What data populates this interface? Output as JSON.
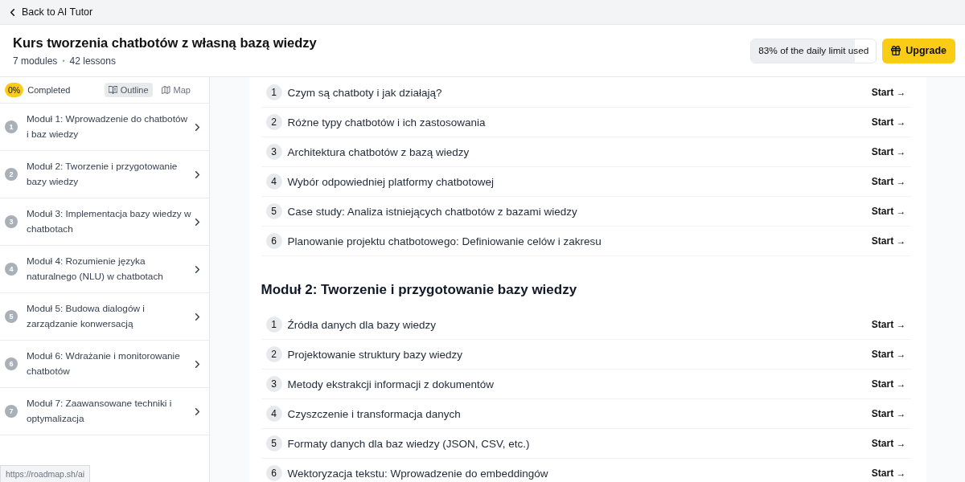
{
  "top_bar": {
    "back_link": "Back to AI Tutor"
  },
  "header": {
    "title": "Kurs tworzenia chatbotów z własną bazą wiedzy",
    "modules_count": "7 modules",
    "separator": "•",
    "lessons_count": "42 lessons",
    "usage": {
      "label": "83% of the daily limit used",
      "level": 0.83
    },
    "upgrade_button": "Upgrade"
  },
  "sidebar": {
    "progress_badge": "0%",
    "progress_label": "Completed",
    "tabs": [
      {
        "label": "Outline",
        "selected": true
      },
      {
        "label": "Map",
        "selected": false
      }
    ],
    "modules": [
      {
        "number": "1",
        "title": "Moduł 1: Wprowadzenie do chatbotów i baz wiedzy"
      },
      {
        "number": "2",
        "title": "Moduł 2: Tworzenie i przygotowanie bazy wiedzy"
      },
      {
        "number": "3",
        "title": "Moduł 3: Implementacja bazy wiedzy w chatbotach"
      },
      {
        "number": "4",
        "title": "Moduł 4: Rozumienie języka naturalnego (NLU) w chatbotach"
      },
      {
        "number": "5",
        "title": "Moduł 5: Budowa dialogów i zarządzanie konwersacją"
      },
      {
        "number": "6",
        "title": "Moduł 6: Wdrażanie i monitorowanie chatbotów"
      },
      {
        "number": "7",
        "title": "Moduł 7: Zaawansowane techniki i optymalizacja"
      }
    ]
  },
  "content": {
    "sections": [
      {
        "lessons": [
          {
            "number": "1",
            "title": "Czym są chatboty i jak działają?",
            "action": "Start →"
          },
          {
            "number": "2",
            "title": "Różne typy chatbotów i ich zastosowania",
            "action": "Start →"
          },
          {
            "number": "3",
            "title": "Architektura chatbotów z bazą wiedzy",
            "action": "Start →"
          },
          {
            "number": "4",
            "title": "Wybór odpowiedniej platformy chatbotowej",
            "action": "Start →"
          },
          {
            "number": "5",
            "title": "Case study: Analiza istniejących chatbotów z bazami wiedzy",
            "action": "Start →"
          },
          {
            "number": "6",
            "title": "Planowanie projektu chatbotowego: Definiowanie celów i zakresu",
            "action": "Start →"
          }
        ]
      },
      {
        "heading": "Moduł 2: Tworzenie i przygotowanie bazy wiedzy",
        "lessons": [
          {
            "number": "1",
            "title": "Źródła danych dla bazy wiedzy",
            "action": "Start →"
          },
          {
            "number": "2",
            "title": "Projektowanie struktury bazy wiedzy",
            "action": "Start →"
          },
          {
            "number": "3",
            "title": "Metody ekstrakcji informacji z dokumentów",
            "action": "Start →"
          },
          {
            "number": "4",
            "title": "Czyszczenie i transformacja danych",
            "action": "Start →"
          },
          {
            "number": "5",
            "title": "Formaty danych dla baz wiedzy (JSON, CSV, etc.)",
            "action": "Start →"
          },
          {
            "number": "6",
            "title": "Wektoryzacja tekstu: Wprowadzenie do embeddingów",
            "action": "Start →"
          }
        ]
      }
    ]
  },
  "status_url": "https://roadmap.sh/ai"
}
